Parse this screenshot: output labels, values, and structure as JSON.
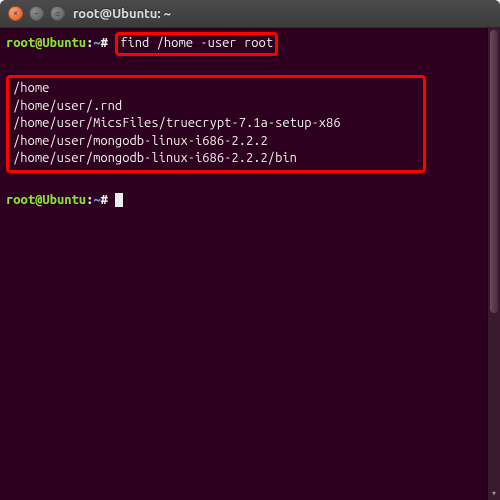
{
  "window": {
    "title": "root@Ubuntu: ~"
  },
  "prompt": {
    "userhost": "root@Ubuntu",
    "colon": ":",
    "path": "~",
    "symbol": "#"
  },
  "command": "find /home -user root",
  "output": [
    "/home",
    "/home/user/.rnd",
    "/home/user/MicsFiles/truecrypt-7.1a-setup-x86",
    "/home/user/mongodb-linux-i686-2.2.2",
    "/home/user/mongodb-linux-i686-2.2.2/bin"
  ],
  "blank": "",
  "icons": {
    "close": "×",
    "min": "–",
    "max": "▫"
  }
}
